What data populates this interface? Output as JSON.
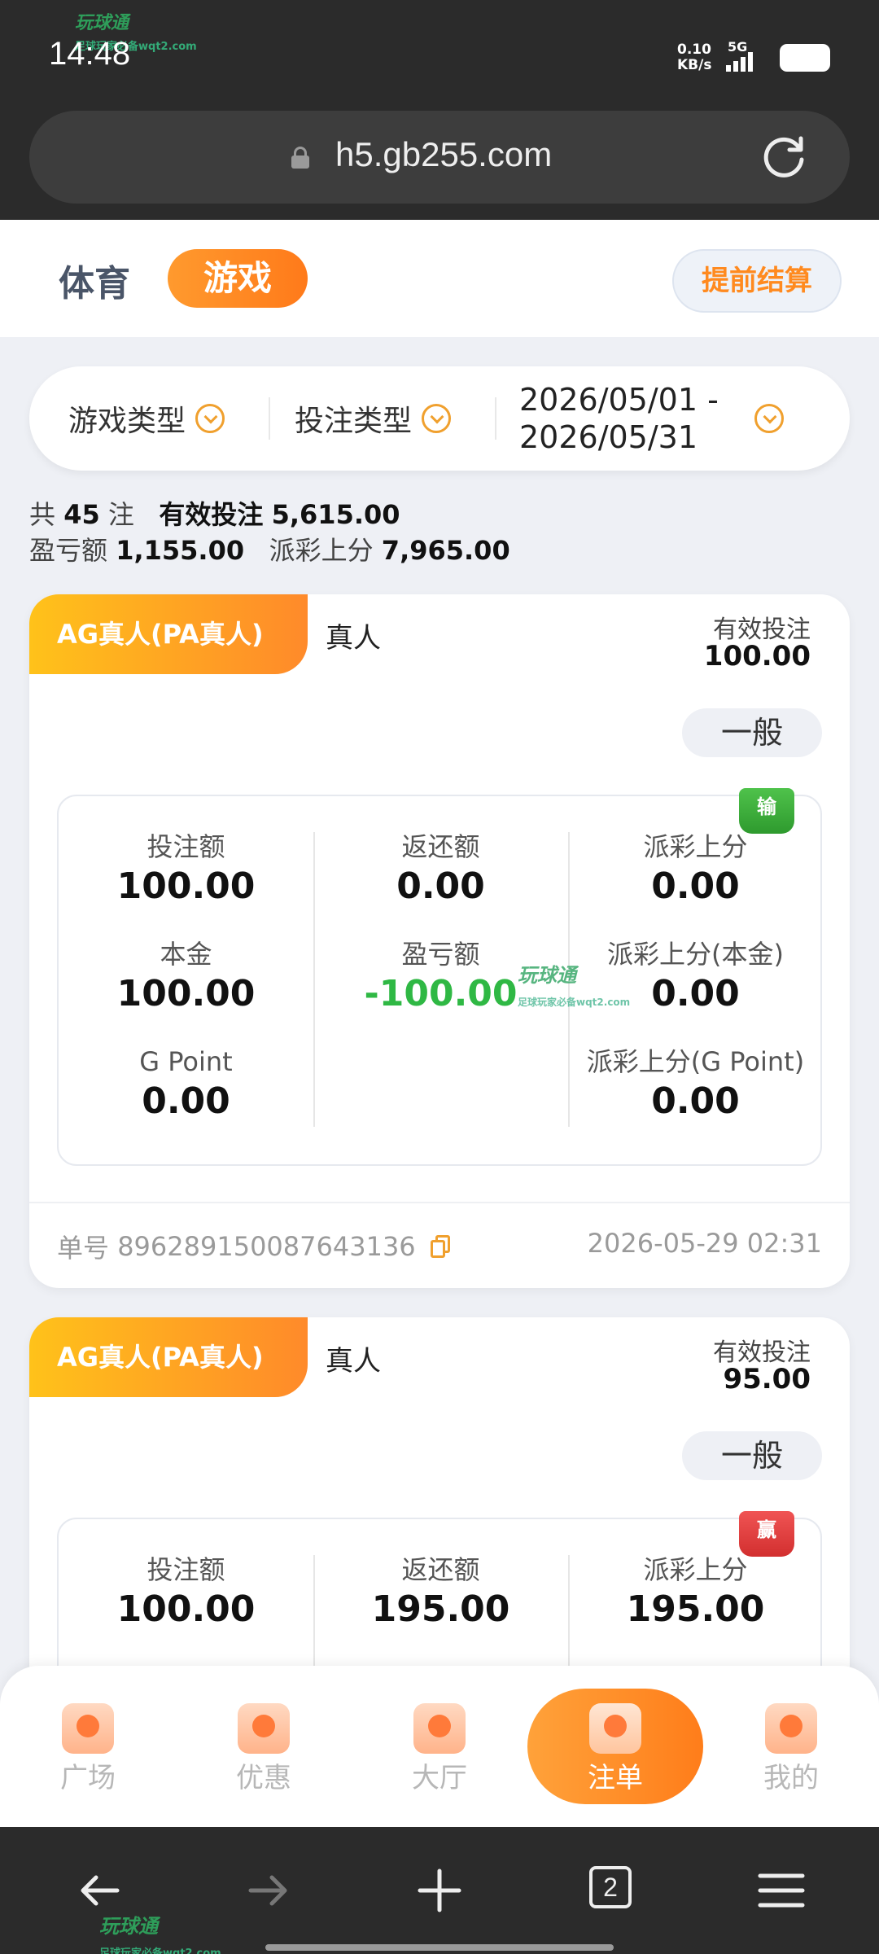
{
  "status_bar": {
    "time": "14:48",
    "net_speed": "0.10",
    "net_unit": "KB/s",
    "network": "5G",
    "watermark": "玩球通",
    "watermark_sub": "足球玩家必备wqt2.com"
  },
  "browser": {
    "url": "h5.gb255.com",
    "tab_count": "2"
  },
  "header": {
    "tab_sports": "体育",
    "tab_games": "游戏",
    "early_settle": "提前结算"
  },
  "filters": {
    "game_type": "游戏类型",
    "bet_type": "投注类型",
    "date_start": "2026/05/01 -",
    "date_end": "2026/05/31"
  },
  "summary": {
    "total_prefix": "共",
    "total_count": "45",
    "total_suffix": "注",
    "valid_label": "有效投注",
    "valid_value": "5,615.00",
    "pnl_label": "盈亏额",
    "pnl_value": "1,155.00",
    "payout_label": "派彩上分",
    "payout_value": "7,965.00"
  },
  "labels": {
    "valid_bet": "有效投注",
    "bet_amount": "投注额",
    "refund": "返还额",
    "payout": "派彩上分",
    "principal": "本金",
    "pnl": "盈亏额",
    "payout_principal": "派彩上分(本金)",
    "g_point": "G Point",
    "payout_g_point": "派彩上分(G Point)",
    "order_prefix": "单号"
  },
  "bets": [
    {
      "platform": "AG真人(PA真人)",
      "type": "真人",
      "valid_bet": "100.00",
      "grade": "一般",
      "result": "输",
      "bet_amount": "100.00",
      "refund": "0.00",
      "payout": "0.00",
      "principal": "100.00",
      "pnl": "-100.00",
      "payout_principal": "0.00",
      "g_point": "0.00",
      "payout_g_point": "0.00",
      "order_no": "896289150087643136",
      "time": "2026-05-29 02:31"
    },
    {
      "platform": "AG真人(PA真人)",
      "type": "真人",
      "valid_bet": "95.00",
      "grade": "一般",
      "result": "赢",
      "bet_amount": "100.00",
      "refund": "195.00",
      "payout": "195.00"
    }
  ],
  "watermark_mid": "玩球通",
  "watermark_mid_sub": "足球玩家必备wqt2.com",
  "app_nav": [
    {
      "label": "广场",
      "icon": "plaza-icon"
    },
    {
      "label": "优惠",
      "icon": "promo-heart-icon"
    },
    {
      "label": "大厅",
      "icon": "lobby-trophy-icon"
    },
    {
      "label": "注单",
      "icon": "bet-slip-icon",
      "active": true
    },
    {
      "label": "我的",
      "icon": "profile-icon"
    }
  ],
  "colors": {
    "accent": "#ff8a1f",
    "loss_green": "#2fb844",
    "win_red": "#d22f2f"
  }
}
